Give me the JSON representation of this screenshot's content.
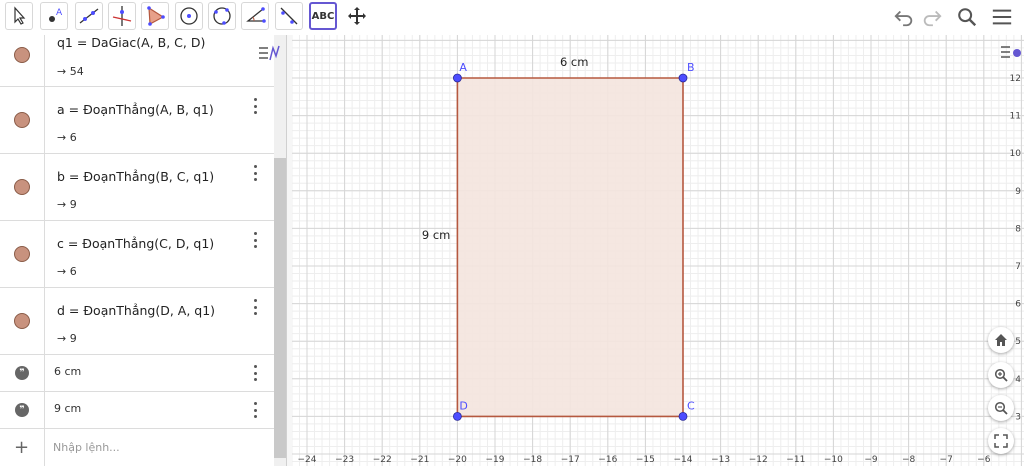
{
  "toolbar": {
    "tools": [
      "move-tool",
      "point-tool",
      "line-tool",
      "perpendicular-line-tool",
      "polygon-tool",
      "circle-center-point-tool",
      "circle-three-points-tool",
      "angle-tool",
      "reflect-tool",
      "text-tool",
      "move-graphics-view-tool"
    ],
    "text_tool_label": "ABC",
    "active_tool": "text-tool"
  },
  "algebra": {
    "rows": [
      {
        "def": "q1 = DaGiac(A, B, C, D)",
        "value": "→ 54"
      },
      {
        "def": "a = ĐoạnThẳng(A, B, q1)",
        "value": "→ 6"
      },
      {
        "def": "b = ĐoạnThẳng(B, C, q1)",
        "value": "→ 9"
      },
      {
        "def": "c = ĐoạnThẳng(C, D, q1)",
        "value": "→ 6"
      },
      {
        "def": "d = ĐoạnThẳng(D, A, q1)",
        "value": "→ 9"
      }
    ],
    "text_rows": [
      {
        "def": "6 cm"
      },
      {
        "def": "9 cm"
      }
    ],
    "input_placeholder": "Nhập lệnh..."
  },
  "graphics": {
    "points": [
      {
        "name": "A",
        "x": -20,
        "y": 12
      },
      {
        "name": "B",
        "x": -14,
        "y": 12
      },
      {
        "name": "C",
        "x": -14,
        "y": 3
      },
      {
        "name": "D",
        "x": -20,
        "y": 3
      }
    ],
    "label_top": "6 cm",
    "label_left": "9 cm",
    "x_ticks": [
      "−24",
      "−23",
      "−22",
      "−21",
      "−20",
      "−19",
      "−18",
      "−17",
      "−16",
      "−15",
      "−14",
      "−13",
      "−12",
      "−11",
      "−10",
      "−9",
      "−8",
      "−7",
      "−6"
    ],
    "y_ticks": [
      "12",
      "11",
      "10",
      "9",
      "8",
      "7",
      "6",
      "5",
      "4",
      "3"
    ],
    "colors": {
      "polygon_fill": "#f4e4de",
      "polygon_stroke": "#b5583f",
      "point": "#4d4dff",
      "accent": "#6557d2"
    }
  }
}
